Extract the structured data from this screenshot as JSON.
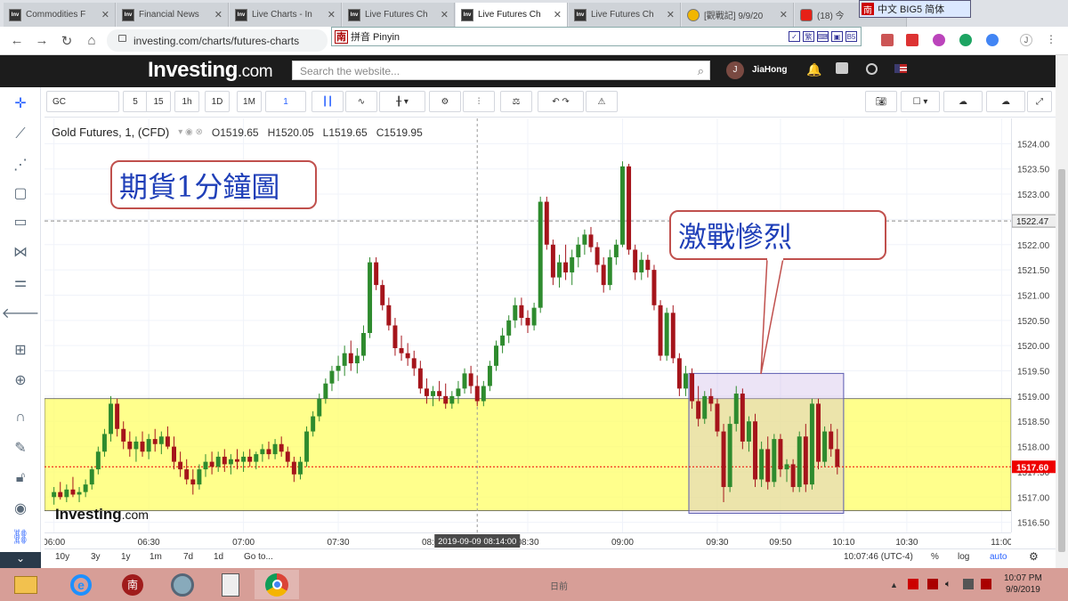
{
  "browser": {
    "tabs": [
      {
        "favicon": "Inv",
        "title": "Commodities F",
        "active": false
      },
      {
        "favicon": "Inv",
        "title": "Financial News",
        "active": false
      },
      {
        "favicon": "Inv",
        "title": "Live Charts - In",
        "active": false
      },
      {
        "favicon": "Inv",
        "title": "Live Futures Ch",
        "active": false
      },
      {
        "favicon": "Inv",
        "title": "Live Futures Ch",
        "active": true
      },
      {
        "favicon": "Inv",
        "title": "Live Futures Ch",
        "active": false
      },
      {
        "favicon": "",
        "title": "[觀戰記] 9/9/20",
        "active": false
      },
      {
        "favicon": "",
        "title": "(18) 今",
        "active": false
      }
    ],
    "url": "investing.com/charts/futures-charts",
    "ime": {
      "nan": "南",
      "label": "拼音 Pinyin",
      "right_label": "中文 BIG5 简体",
      "boxes": [
        "✓",
        "繁",
        "⌨",
        "▣",
        "B5"
      ]
    }
  },
  "site": {
    "logo_main": "Investing",
    "logo_dot": ".com",
    "search_placeholder": "Search the website...",
    "avatar_initial": "J",
    "username": "JiaHong"
  },
  "toolbar": {
    "symbol": "GC",
    "intervals": [
      "5",
      "15",
      "1h",
      "1D",
      "1M",
      "1"
    ],
    "active_interval": "1"
  },
  "legend": {
    "title": "Gold Futures, 1, (CFD)",
    "open": "O1519.65",
    "high": "H1520.05",
    "low": "L1519.65",
    "close": "C1519.95"
  },
  "annotations": {
    "left": "期貨1分鐘圖",
    "right": "激戰慘烈"
  },
  "watermark": {
    "main": "Investing",
    "dot": ".com"
  },
  "chart_data": {
    "type": "candlestick",
    "title": "Gold Futures, 1, (CFD)",
    "ylim": [
      1516.3,
      1524.5
    ],
    "price_ticks": [
      "1524.00",
      "1523.50",
      "1523.00",
      "1522.50",
      "1522.00",
      "1521.50",
      "1521.00",
      "1520.50",
      "1520.00",
      "1519.50",
      "1519.00",
      "1518.50",
      "1518.00",
      "1517.50",
      "1517.00",
      "1516.50"
    ],
    "time_ticks": [
      "06:00",
      "06:30",
      "07:00",
      "07:30",
      "08:00",
      "08:30",
      "09:00",
      "09:30",
      "09:50",
      "10:10",
      "10:30",
      "11:00"
    ],
    "current_price_label": "1517.60",
    "current_price": 1517.6,
    "horizontal_line_label": "1522.47",
    "horizontal_line": 1522.47,
    "crosshair_time_label": "2019-09-09 08:14:00",
    "yellow_band": [
      1516.73,
      1518.95
    ],
    "highlight_box": {
      "x_from": "09:21",
      "x_to": "10:10",
      "y_from": 1516.68,
      "y_to": 1519.45
    },
    "candles": [
      [
        "06:00",
        1517.0,
        1517.2,
        1516.85,
        1517.1
      ],
      [
        "06:02",
        1517.1,
        1517.3,
        1516.95,
        1517.0
      ],
      [
        "06:04",
        1517.0,
        1517.25,
        1516.9,
        1517.15
      ],
      [
        "06:06",
        1517.15,
        1517.4,
        1517.0,
        1517.05
      ],
      [
        "06:08",
        1517.05,
        1517.2,
        1516.9,
        1517.1
      ],
      [
        "06:10",
        1517.1,
        1517.35,
        1517.0,
        1517.25
      ],
      [
        "06:12",
        1517.25,
        1517.6,
        1517.15,
        1517.55
      ],
      [
        "06:14",
        1517.55,
        1518.0,
        1517.45,
        1517.9
      ],
      [
        "06:16",
        1517.9,
        1518.35,
        1517.8,
        1518.25
      ],
      [
        "06:18",
        1518.25,
        1519.0,
        1518.1,
        1518.85
      ],
      [
        "06:20",
        1518.85,
        1518.95,
        1518.2,
        1518.35
      ],
      [
        "06:22",
        1518.35,
        1518.5,
        1517.95,
        1518.1
      ],
      [
        "06:24",
        1518.1,
        1518.3,
        1517.8,
        1517.95
      ],
      [
        "06:26",
        1517.95,
        1518.2,
        1517.7,
        1518.1
      ],
      [
        "06:28",
        1518.1,
        1518.3,
        1517.8,
        1517.9
      ],
      [
        "06:30",
        1517.9,
        1518.25,
        1517.75,
        1518.15
      ],
      [
        "06:32",
        1518.15,
        1518.35,
        1517.9,
        1518.05
      ],
      [
        "06:34",
        1518.05,
        1518.3,
        1517.85,
        1518.2
      ],
      [
        "06:36",
        1518.2,
        1518.4,
        1517.95,
        1518.0
      ],
      [
        "06:38",
        1518.0,
        1518.2,
        1517.55,
        1517.7
      ],
      [
        "06:40",
        1517.7,
        1517.9,
        1517.4,
        1517.55
      ],
      [
        "06:42",
        1517.55,
        1517.75,
        1517.25,
        1517.35
      ],
      [
        "06:44",
        1517.35,
        1517.55,
        1517.05,
        1517.25
      ],
      [
        "06:46",
        1517.25,
        1517.65,
        1517.15,
        1517.55
      ],
      [
        "06:48",
        1517.55,
        1517.85,
        1517.4,
        1517.7
      ],
      [
        "06:50",
        1517.7,
        1517.9,
        1517.45,
        1517.6
      ],
      [
        "06:52",
        1517.6,
        1517.9,
        1517.5,
        1517.8
      ],
      [
        "06:54",
        1517.8,
        1517.95,
        1517.5,
        1517.65
      ],
      [
        "06:56",
        1517.65,
        1517.85,
        1517.45,
        1517.75
      ],
      [
        "06:58",
        1517.75,
        1517.95,
        1517.55,
        1517.7
      ],
      [
        "07:00",
        1517.7,
        1517.9,
        1517.5,
        1517.8
      ],
      [
        "07:02",
        1517.8,
        1517.95,
        1517.6,
        1517.7
      ],
      [
        "07:04",
        1517.7,
        1517.9,
        1517.55,
        1517.85
      ],
      [
        "07:06",
        1517.85,
        1518.05,
        1517.7,
        1517.95
      ],
      [
        "07:08",
        1517.95,
        1518.1,
        1517.75,
        1517.85
      ],
      [
        "07:10",
        1517.85,
        1518.15,
        1517.75,
        1518.05
      ],
      [
        "07:12",
        1518.05,
        1518.2,
        1517.8,
        1517.9
      ],
      [
        "07:14",
        1517.9,
        1518.0,
        1517.6,
        1517.7
      ],
      [
        "07:16",
        1517.7,
        1517.8,
        1517.3,
        1517.45
      ],
      [
        "07:18",
        1517.45,
        1517.8,
        1517.35,
        1517.7
      ],
      [
        "07:20",
        1517.7,
        1518.4,
        1517.6,
        1518.3
      ],
      [
        "07:22",
        1518.3,
        1518.7,
        1518.2,
        1518.6
      ],
      [
        "07:24",
        1518.6,
        1519.05,
        1518.5,
        1518.95
      ],
      [
        "07:26",
        1518.95,
        1519.35,
        1518.85,
        1519.25
      ],
      [
        "07:28",
        1519.25,
        1519.6,
        1519.1,
        1519.5
      ],
      [
        "07:30",
        1519.5,
        1519.8,
        1519.3,
        1519.6
      ],
      [
        "07:32",
        1519.6,
        1520.0,
        1519.4,
        1519.85
      ],
      [
        "07:34",
        1519.85,
        1520.1,
        1519.5,
        1519.65
      ],
      [
        "07:36",
        1519.65,
        1519.95,
        1519.45,
        1519.8
      ],
      [
        "07:38",
        1519.8,
        1520.4,
        1519.7,
        1520.25
      ],
      [
        "07:40",
        1520.25,
        1521.75,
        1520.15,
        1521.65
      ],
      [
        "07:42",
        1521.65,
        1521.75,
        1521.1,
        1521.2
      ],
      [
        "07:44",
        1521.2,
        1521.3,
        1520.7,
        1520.8
      ],
      [
        "07:46",
        1520.8,
        1520.95,
        1520.3,
        1520.4
      ],
      [
        "07:48",
        1520.4,
        1520.55,
        1519.8,
        1519.95
      ],
      [
        "07:50",
        1519.95,
        1520.2,
        1519.7,
        1519.85
      ],
      [
        "07:52",
        1519.85,
        1520.05,
        1519.6,
        1519.75
      ],
      [
        "07:54",
        1519.75,
        1519.9,
        1519.4,
        1519.55
      ],
      [
        "07:56",
        1519.55,
        1519.7,
        1519.05,
        1519.15
      ],
      [
        "07:58",
        1519.15,
        1519.35,
        1518.85,
        1519.0
      ],
      [
        "08:00",
        1519.0,
        1519.2,
        1518.8,
        1519.1
      ],
      [
        "08:02",
        1519.1,
        1519.3,
        1518.9,
        1519.0
      ],
      [
        "08:04",
        1519.0,
        1519.25,
        1518.75,
        1518.85
      ],
      [
        "08:06",
        1518.85,
        1519.1,
        1518.75,
        1519.0
      ],
      [
        "08:08",
        1519.0,
        1519.3,
        1518.85,
        1519.15
      ],
      [
        "08:10",
        1519.15,
        1519.55,
        1519.05,
        1519.45
      ],
      [
        "08:12",
        1519.45,
        1519.6,
        1519.05,
        1519.2
      ],
      [
        "08:14",
        1519.2,
        1519.4,
        1518.8,
        1518.9
      ],
      [
        "08:16",
        1518.9,
        1519.3,
        1518.8,
        1519.2
      ],
      [
        "08:18",
        1519.2,
        1519.7,
        1519.1,
        1519.6
      ],
      [
        "08:20",
        1519.6,
        1520.1,
        1519.5,
        1520.0
      ],
      [
        "08:22",
        1520.0,
        1520.35,
        1519.85,
        1520.2
      ],
      [
        "08:24",
        1520.2,
        1520.6,
        1520.05,
        1520.5
      ],
      [
        "08:26",
        1520.5,
        1520.95,
        1520.35,
        1520.8
      ],
      [
        "08:28",
        1520.8,
        1520.95,
        1520.4,
        1520.55
      ],
      [
        "08:30",
        1520.55,
        1520.7,
        1520.25,
        1520.4
      ],
      [
        "08:32",
        1520.4,
        1520.85,
        1520.3,
        1520.75
      ],
      [
        "08:34",
        1520.75,
        1522.95,
        1520.65,
        1522.85
      ],
      [
        "08:36",
        1522.85,
        1522.95,
        1521.9,
        1522.0
      ],
      [
        "08:38",
        1522.0,
        1522.1,
        1521.2,
        1521.35
      ],
      [
        "08:40",
        1521.35,
        1521.8,
        1521.15,
        1521.65
      ],
      [
        "08:42",
        1521.65,
        1522.0,
        1521.3,
        1521.45
      ],
      [
        "08:44",
        1521.45,
        1521.9,
        1521.2,
        1521.75
      ],
      [
        "08:46",
        1521.75,
        1522.15,
        1521.55,
        1522.0
      ],
      [
        "08:48",
        1522.0,
        1522.3,
        1521.8,
        1522.2
      ],
      [
        "08:50",
        1522.2,
        1522.35,
        1521.85,
        1521.95
      ],
      [
        "08:52",
        1521.95,
        1522.05,
        1521.45,
        1521.6
      ],
      [
        "08:54",
        1521.6,
        1521.75,
        1521.05,
        1521.2
      ],
      [
        "08:56",
        1521.2,
        1521.9,
        1521.1,
        1521.75
      ],
      [
        "08:58",
        1521.75,
        1522.1,
        1521.6,
        1522.0
      ],
      [
        "09:00",
        1522.0,
        1523.65,
        1521.95,
        1523.55
      ],
      [
        "09:02",
        1523.55,
        1523.6,
        1521.8,
        1521.9
      ],
      [
        "09:04",
        1521.9,
        1522.0,
        1521.3,
        1521.45
      ],
      [
        "09:06",
        1521.45,
        1521.85,
        1521.3,
        1521.7
      ],
      [
        "09:08",
        1521.7,
        1521.8,
        1521.35,
        1521.5
      ],
      [
        "09:10",
        1521.5,
        1521.6,
        1520.7,
        1520.8
      ],
      [
        "09:12",
        1520.8,
        1520.9,
        1519.7,
        1519.8
      ],
      [
        "09:14",
        1519.8,
        1520.75,
        1519.7,
        1520.65
      ],
      [
        "09:16",
        1520.65,
        1520.8,
        1519.65,
        1519.75
      ],
      [
        "09:18",
        1519.75,
        1519.85,
        1519.0,
        1519.15
      ],
      [
        "09:20",
        1519.15,
        1519.6,
        1519.0,
        1519.45
      ],
      [
        "09:22",
        1519.45,
        1519.55,
        1518.75,
        1518.9
      ],
      [
        "09:24",
        1518.9,
        1519.2,
        1518.4,
        1518.55
      ],
      [
        "09:26",
        1518.55,
        1519.1,
        1518.45,
        1519.0
      ],
      [
        "09:28",
        1519.0,
        1519.15,
        1518.7,
        1518.85
      ],
      [
        "09:30",
        1518.85,
        1518.95,
        1518.2,
        1518.3
      ],
      [
        "09:32",
        1518.3,
        1518.45,
        1516.9,
        1517.2
      ],
      [
        "09:34",
        1517.2,
        1518.6,
        1517.1,
        1518.45
      ],
      [
        "09:36",
        1518.45,
        1519.2,
        1518.3,
        1519.05
      ],
      [
        "09:38",
        1519.05,
        1519.15,
        1517.95,
        1518.1
      ],
      [
        "09:40",
        1518.1,
        1518.6,
        1517.9,
        1518.5
      ],
      [
        "09:42",
        1518.5,
        1518.65,
        1517.2,
        1517.35
      ],
      [
        "09:44",
        1517.35,
        1518.1,
        1517.2,
        1517.95
      ],
      [
        "09:46",
        1517.95,
        1518.2,
        1517.15,
        1517.3
      ],
      [
        "09:48",
        1517.3,
        1518.25,
        1517.2,
        1518.15
      ],
      [
        "09:50",
        1518.15,
        1518.25,
        1517.4,
        1517.55
      ],
      [
        "09:52",
        1517.55,
        1517.75,
        1517.3,
        1517.65
      ],
      [
        "09:54",
        1517.65,
        1517.75,
        1517.1,
        1517.2
      ],
      [
        "09:56",
        1517.2,
        1518.3,
        1517.1,
        1518.2
      ],
      [
        "09:58",
        1518.2,
        1518.45,
        1517.1,
        1517.25
      ],
      [
        "10:00",
        1517.25,
        1518.95,
        1517.15,
        1518.85
      ],
      [
        "10:02",
        1518.85,
        1518.95,
        1517.55,
        1517.7
      ],
      [
        "10:04",
        1517.7,
        1518.4,
        1517.6,
        1518.3
      ],
      [
        "10:06",
        1518.3,
        1518.45,
        1517.8,
        1517.95
      ],
      [
        "10:08",
        1517.95,
        1518.35,
        1517.45,
        1517.6
      ]
    ]
  },
  "timeaxis": {
    "crosshair_label": "2019-09-09 08:14:00"
  },
  "bottombar": {
    "ranges": [
      "10y",
      "3y",
      "1y",
      "1m",
      "7d",
      "1d",
      "Go to..."
    ],
    "clock": "10:07:46 (UTC-4)",
    "pct": "%",
    "log": "log",
    "auto": "auto"
  },
  "taskbar": {
    "center_text": "日前",
    "time": "10:07 PM",
    "date": "9/9/2019"
  }
}
